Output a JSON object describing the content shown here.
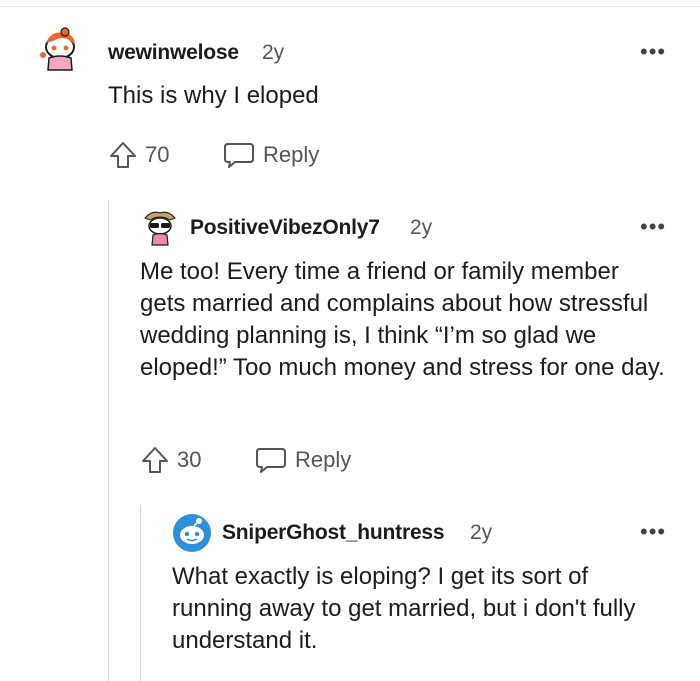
{
  "comments": [
    {
      "username": "wewinwelose",
      "age": "2y",
      "body": "This is why I eloped",
      "votes": "70",
      "reply_label": "Reply",
      "more_icon": "more-horizontal-icon"
    },
    {
      "username": "PositiveVibezOnly7",
      "age": "2y",
      "body": "Me too! Every time a friend or family member gets married and complains about how stressful wedding planning is, I think “I’m so glad we eloped!” Too much money and stress for one day.",
      "votes": "30",
      "reply_label": "Reply",
      "more_icon": "more-horizontal-icon"
    },
    {
      "username": "SniperGhost_huntress",
      "age": "2y",
      "body": "What exactly is eloping? I get its sort of running away to get married, but i don't fully understand it.",
      "more_icon": "more-horizontal-icon"
    }
  ],
  "colors": {
    "upvote_gray": "#555555",
    "thread_line": "#d8d8d8",
    "avatar_blue": "#2f8fd8"
  }
}
